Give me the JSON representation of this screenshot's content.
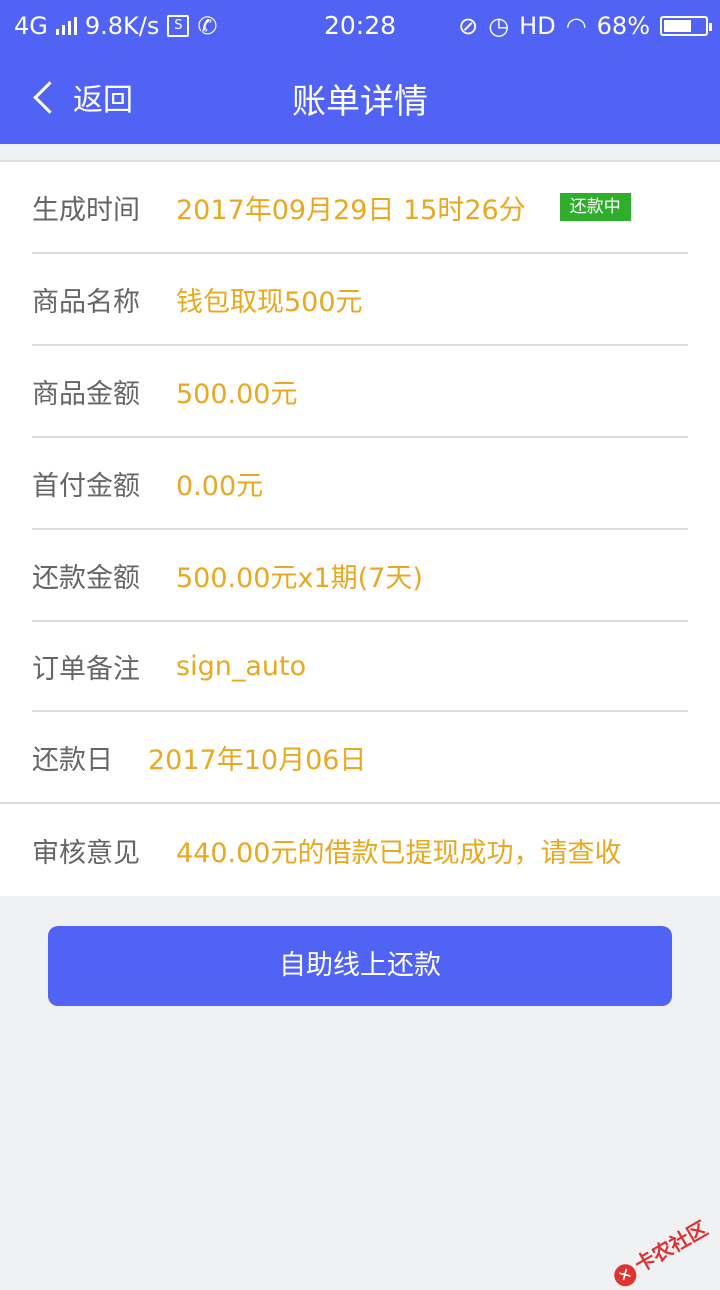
{
  "status_bar": {
    "network": "4G",
    "speed": "9.8K/s",
    "sim_icon": "S",
    "time": "20:28",
    "hd": "HD",
    "battery": "68%",
    "battery_level": 0.68
  },
  "nav": {
    "back_label": "返回",
    "title": "账单详情"
  },
  "details": {
    "created": {
      "label": "生成时间",
      "value": "2017年09月29日 15时26分",
      "badge": "还款中"
    },
    "product": {
      "label": "商品名称",
      "value": "钱包取现500元"
    },
    "amount": {
      "label": "商品金额",
      "value": "500.00元"
    },
    "down_payment": {
      "label": "首付金额",
      "value": "0.00元"
    },
    "repayment": {
      "label": "还款金额",
      "value": "500.00元x1期(7天)"
    },
    "remark": {
      "label": "订单备注",
      "value": "sign_auto"
    },
    "due_date": {
      "label": "还款日",
      "value": "2017年10月06日"
    },
    "review": {
      "label": "审核意见",
      "value": "440.00元的借款已提现成功，请查收"
    }
  },
  "repay_button": "自助线上还款",
  "watermark": "卡农社区",
  "colors": {
    "primary": "#5163f5",
    "value_text": "#e8a820",
    "badge": "#2fae2b"
  }
}
